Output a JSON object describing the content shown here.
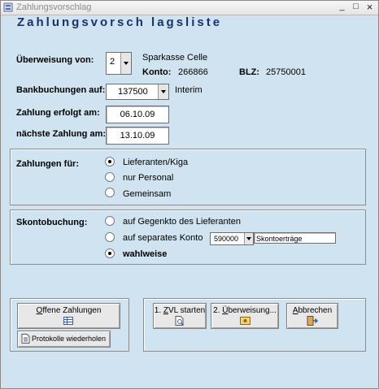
{
  "window": {
    "title": "Zahlungsvorschlag",
    "min_symbol": "_",
    "max_symbol": "□",
    "close_symbol": "×"
  },
  "heading": "Zahlungsvorsch lagsliste",
  "ueberweisung": {
    "label": "Überweisung von:",
    "value": "2",
    "bank": "Sparkasse Celle",
    "konto_label": "Konto:",
    "konto_value": "266866",
    "blz_label": "BLZ:",
    "blz_value": "25750001"
  },
  "bankbuchungen": {
    "label": "Bankbuchungen auf:",
    "value": "137500",
    "name": "Interim"
  },
  "zahlung_erfolgt": {
    "label": "Zahlung erfolgt am:",
    "value": "06.10.09"
  },
  "naechste_zahlung": {
    "label": "nächste Zahlung  am:",
    "value": "13.10.09"
  },
  "zahlungen_fuer": {
    "label": "Zahlungen für:",
    "options": [
      "Lieferanten/Kiga",
      "nur Personal",
      "Gemeinsam"
    ],
    "selected": 0
  },
  "skonto": {
    "label": "Skontobuchung:",
    "options": [
      "auf Gegenkto des Lieferanten",
      "auf separates Konto",
      "wahlweise"
    ],
    "selected": 2,
    "konto_value": "590000",
    "konto_name": "Skontoerträge"
  },
  "buttons": {
    "offene_first": "O",
    "offene_rest": "ffene Zahlungen",
    "protokolle": "Protokolle wiederholen",
    "zvl_prefix": "1. ",
    "zvl_first": "Z",
    "zvl_rest": "VL starten",
    "ueberweisung_prefix": "2. ",
    "ueberweisung_first": "Ü",
    "ueberweisung_rest": "berweisung...",
    "abbrechen_first": "A",
    "abbrechen_rest": "bbrechen"
  },
  "colors": {
    "background": "#cfe3f1",
    "heading": "#17336a"
  }
}
